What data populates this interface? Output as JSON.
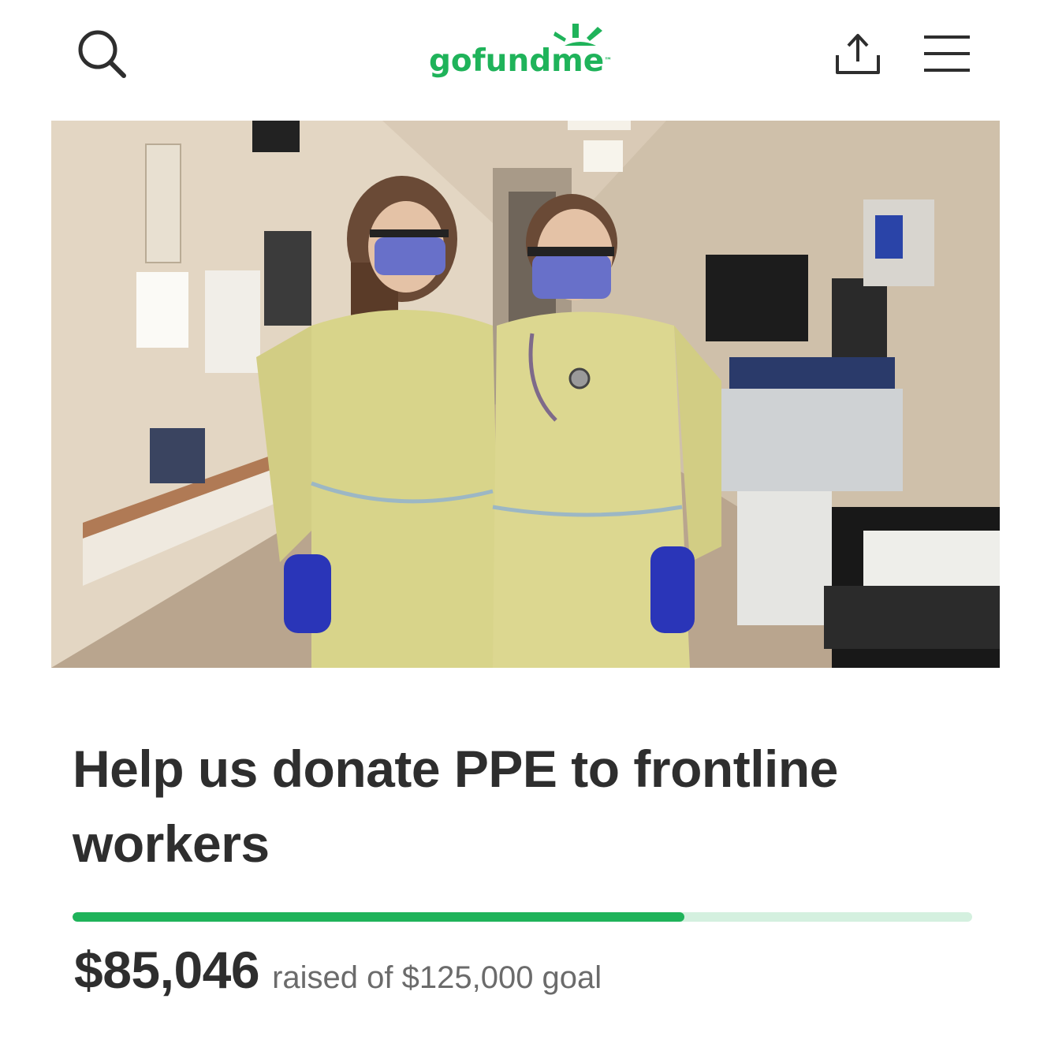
{
  "header": {
    "logo": {
      "text_prefix": "gofund",
      "text_suffix": "me",
      "trademark": "™"
    },
    "icons": {
      "search": "search-icon",
      "share": "share-icon",
      "menu": "menu-icon"
    }
  },
  "hero": {
    "image": "photo of two healthcare workers in yellow gowns, masks and blue gloves in a hospital hallway"
  },
  "campaign": {
    "title": "Help us donate PPE to frontline workers",
    "raised": "$85,046",
    "goal_text": "raised of $125,000 goal",
    "progress": 0.68
  },
  "colors": {
    "brand_green": "#1fb35a",
    "progress_track": "#d4f0df",
    "progress_fill": "#1fb35a",
    "icon": "#2e2e2e"
  }
}
